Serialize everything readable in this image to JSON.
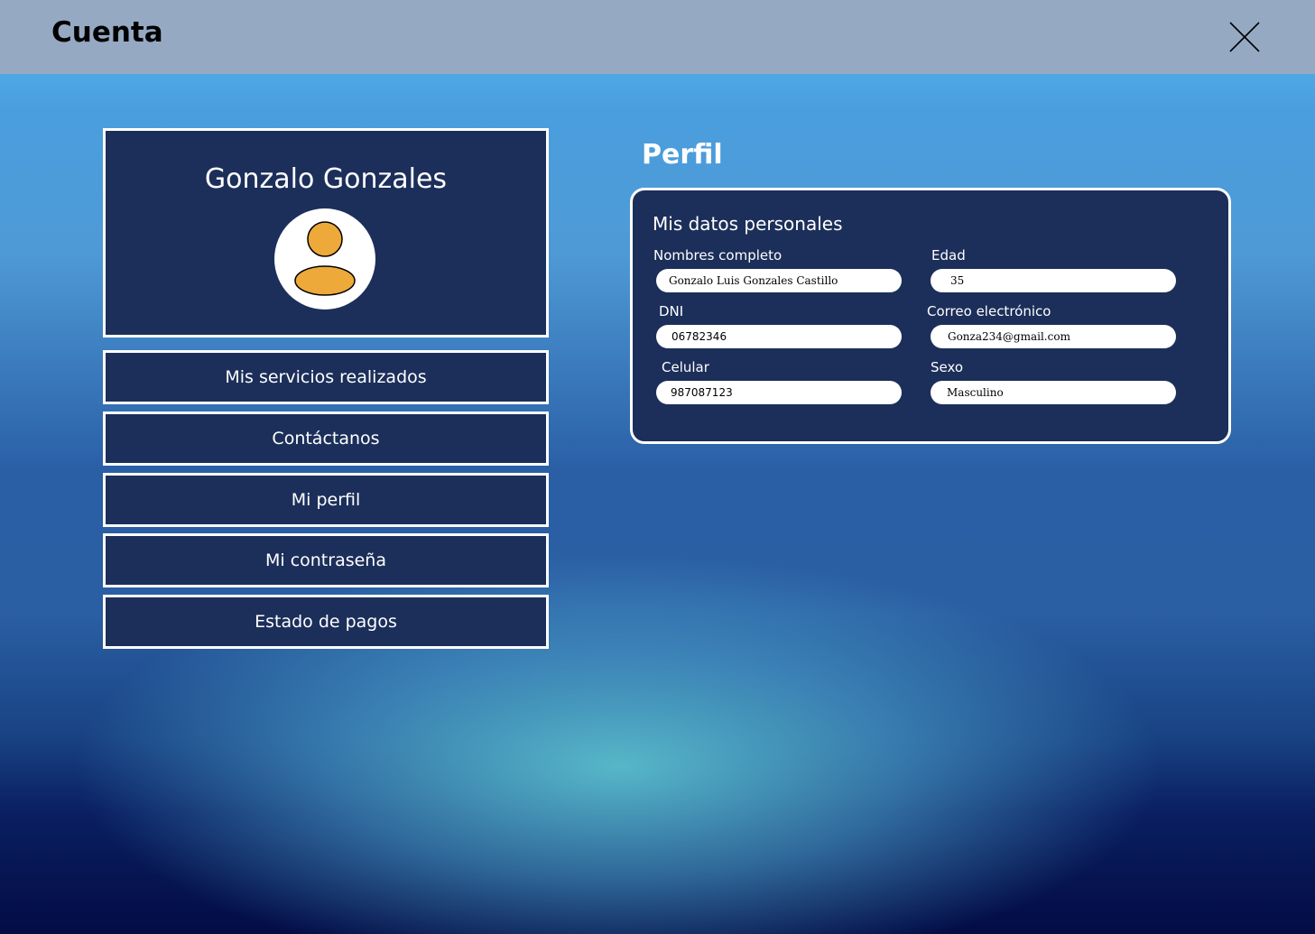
{
  "header": {
    "title": "Cuenta",
    "close_icon": "close-icon"
  },
  "profile": {
    "name": "Gonzalo Gonzales",
    "avatar_icon": "user-avatar-icon",
    "avatar_color": "#eda93a"
  },
  "menu": [
    {
      "label": "Mis servicios realizados"
    },
    {
      "label": "Contáctanos"
    },
    {
      "label": "Mi perfil"
    },
    {
      "label": "Mi contraseña"
    },
    {
      "label": "Estado de pagos"
    }
  ],
  "main": {
    "section_title": "Perfil",
    "card_title": "Mis datos personales",
    "fields": {
      "full_name": {
        "label": "Nombres completo",
        "value": "Gonzalo Luis Gonzales Castillo"
      },
      "age": {
        "label": "Edad",
        "value": "35"
      },
      "dni": {
        "label": "DNI",
        "value": "06782346"
      },
      "email": {
        "label": "Correo electrónico",
        "value": "Gonza234@gmail.com"
      },
      "phone": {
        "label": "Celular",
        "value": "987087123"
      },
      "sex": {
        "label": "Sexo",
        "value": "Masculino"
      }
    }
  },
  "colors": {
    "topbar": "#95a9c3",
    "panel": "#1c2f5a",
    "accent": "#eda93a"
  }
}
